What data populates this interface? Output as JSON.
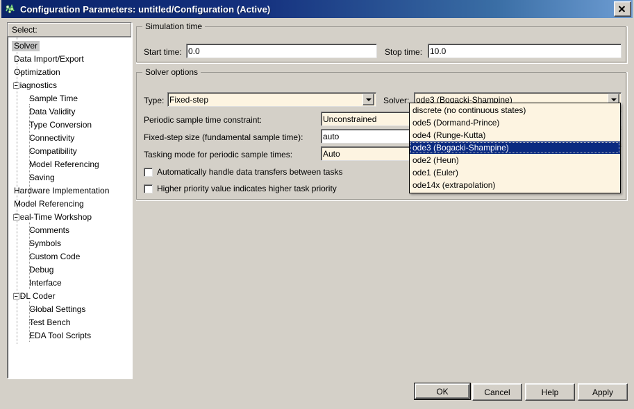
{
  "window": {
    "title": "Configuration Parameters: untitled/Configuration (Active)",
    "icon": "simulink-icon",
    "close_label": "×",
    "titlebar_color": "#0a246a",
    "face_color": "#d4d0c8",
    "field_color": "#fdf4e1",
    "highlight_color": "#0a2a80"
  },
  "sidebar": {
    "header": "Select:",
    "items": [
      {
        "label": "Solver",
        "level": 0,
        "selected": true,
        "expander": false
      },
      {
        "label": "Data Import/Export",
        "level": 0,
        "selected": false,
        "expander": false
      },
      {
        "label": "Optimization",
        "level": 0,
        "selected": false,
        "expander": false
      },
      {
        "label": "Diagnostics",
        "level": 0,
        "selected": false,
        "expander": true
      },
      {
        "label": "Sample Time",
        "level": 1,
        "selected": false,
        "expander": false
      },
      {
        "label": "Data Validity",
        "level": 1,
        "selected": false,
        "expander": false
      },
      {
        "label": "Type Conversion",
        "level": 1,
        "selected": false,
        "expander": false
      },
      {
        "label": "Connectivity",
        "level": 1,
        "selected": false,
        "expander": false
      },
      {
        "label": "Compatibility",
        "level": 1,
        "selected": false,
        "expander": false
      },
      {
        "label": "Model Referencing",
        "level": 1,
        "selected": false,
        "expander": false
      },
      {
        "label": "Saving",
        "level": 1,
        "selected": false,
        "expander": false
      },
      {
        "label": "Hardware Implementation",
        "level": 0,
        "selected": false,
        "expander": false
      },
      {
        "label": "Model Referencing",
        "level": 0,
        "selected": false,
        "expander": false
      },
      {
        "label": "Real-Time Workshop",
        "level": 0,
        "selected": false,
        "expander": true
      },
      {
        "label": "Comments",
        "level": 1,
        "selected": false,
        "expander": false
      },
      {
        "label": "Symbols",
        "level": 1,
        "selected": false,
        "expander": false
      },
      {
        "label": "Custom Code",
        "level": 1,
        "selected": false,
        "expander": false
      },
      {
        "label": "Debug",
        "level": 1,
        "selected": false,
        "expander": false
      },
      {
        "label": "Interface",
        "level": 1,
        "selected": false,
        "expander": false
      },
      {
        "label": "HDL Coder",
        "level": 0,
        "selected": false,
        "expander": true
      },
      {
        "label": "Global Settings",
        "level": 1,
        "selected": false,
        "expander": false
      },
      {
        "label": "Test Bench",
        "level": 1,
        "selected": false,
        "expander": false
      },
      {
        "label": "EDA Tool Scripts",
        "level": 1,
        "selected": false,
        "expander": false
      }
    ]
  },
  "simulation_time": {
    "group_title": "Simulation time",
    "start_label": "Start time:",
    "start_value": "0.0",
    "stop_label": "Stop time:",
    "stop_value": "10.0"
  },
  "solver_options": {
    "group_title": "Solver options",
    "type_label": "Type:",
    "type_value": "Fixed-step",
    "solver_label": "Solver:",
    "solver_value": "ode3 (Bogacki-Shampine)",
    "constraint_label": "Periodic sample time constraint:",
    "constraint_value": "Unconstrained",
    "stepsize_label": "Fixed-step size (fundamental sample time):",
    "stepsize_value": "auto",
    "tasking_label": "Tasking mode for periodic sample times:",
    "tasking_value": "Auto",
    "checkbox_auto_transfer": "Automatically handle data transfers between tasks",
    "checkbox_auto_transfer_checked": false,
    "checkbox_priority": "Higher priority value indicates higher task priority",
    "checkbox_priority_checked": false
  },
  "solver_dropdown": {
    "open": true,
    "selected_index": 3,
    "options": [
      "discrete (no continuous states)",
      "ode5 (Dormand-Prince)",
      "ode4 (Runge-Kutta)",
      "ode3 (Bogacki-Shampine)",
      "ode2 (Heun)",
      "ode1 (Euler)",
      "ode14x (extrapolation)"
    ]
  },
  "buttons": {
    "ok": "OK",
    "cancel": "Cancel",
    "help": "Help",
    "apply": "Apply"
  }
}
